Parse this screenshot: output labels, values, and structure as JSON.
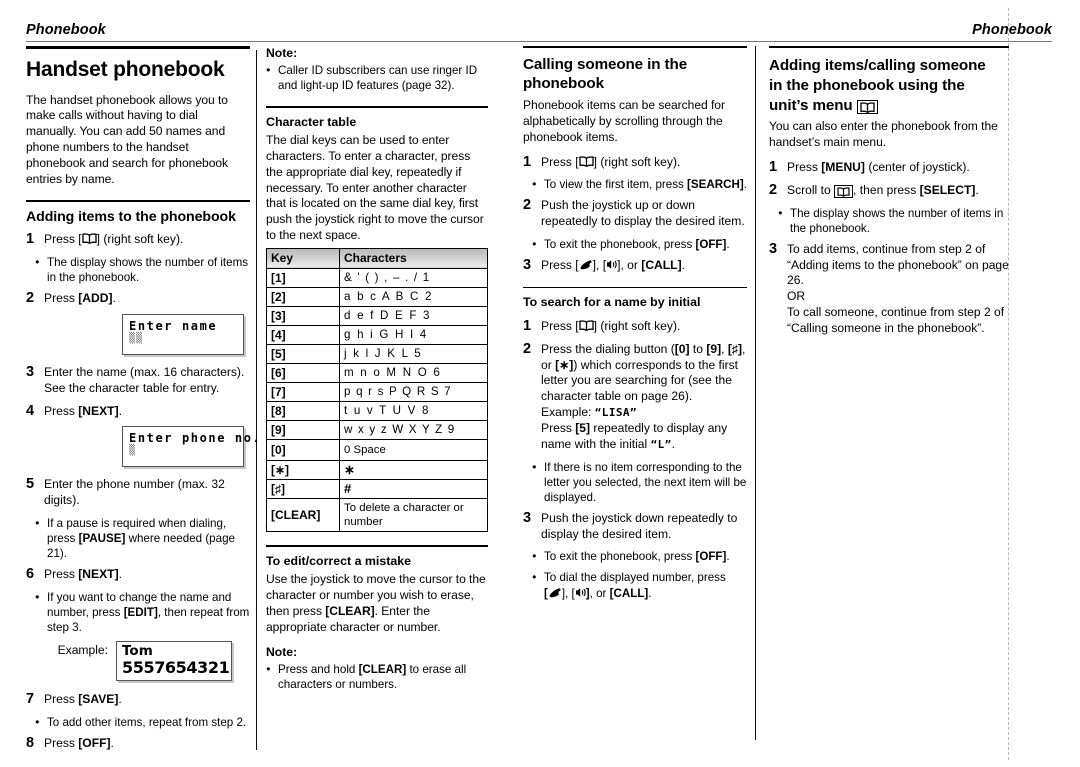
{
  "running_head": {
    "left": "Phonebook",
    "right": "Phonebook"
  },
  "col1": {
    "title": "Handset phonebook",
    "intro": "The handset phonebook allows you to make calls without having to dial manually. You can add 50 names and phone numbers to the handset phonebook and search for phonebook entries by name.",
    "subhead": "Adding items to the phonebook",
    "step1": {
      "num": "1",
      "pre": "Press [",
      "icon": "phonebook-book-icon",
      "post": "] (right soft key)."
    },
    "step1_bullet": "The display shows the number of items in the phonebook.",
    "step2": {
      "num": "2",
      "text_pre": "Press ",
      "key": "[ADD]",
      "text_post": "."
    },
    "lcd1": {
      "line1": "Enter name",
      "line2": ""
    },
    "step3": {
      "num": "3",
      "text": "Enter the name (max. 16 characters). See the character table for entry."
    },
    "step4": {
      "num": "4",
      "text_pre": "Press ",
      "key": "[NEXT]",
      "text_post": "."
    },
    "lcd2": {
      "line1": "Enter phone no.",
      "line2": ""
    },
    "step5": {
      "num": "5",
      "text": "Enter the phone number (max. 32 digits)."
    },
    "step5_bullet_pre": "If a pause is required when dialing, press ",
    "step5_bullet_key": "[PAUSE]",
    "step5_bullet_post": " where needed (page 21).",
    "step6": {
      "num": "6",
      "text_pre": "Press ",
      "key": "[NEXT]",
      "text_post": "."
    },
    "step6_bullet_pre": "If you want to change the name and number, press ",
    "step6_bullet_key": "[EDIT]",
    "step6_bullet_post": ", then repeat from step 3.",
    "example_label": "Example:",
    "example_lcd": {
      "name": "Tom",
      "number": "5557654321"
    },
    "step7": {
      "num": "7",
      "text_pre": "Press ",
      "key": "[SAVE]",
      "text_post": "."
    },
    "step7_bullet": "To add other items, repeat from step 2.",
    "step8": {
      "num": "8",
      "text_pre": "Press ",
      "key": "[OFF]",
      "text_post": "."
    }
  },
  "col2": {
    "note_label": "Note:",
    "note_text": "Caller ID subscribers can use ringer ID and light-up ID features (page 32).",
    "chartable_head": "Character table",
    "chartable_intro": "The dial keys can be used to enter characters. To enter a character, press the appropriate dial key, repeatedly if necessary. To enter another character that is located on the same dial key, first push the joystick right to move the cursor to the next space.",
    "table": {
      "headers": [
        "Key",
        "Characters"
      ],
      "rows": [
        {
          "key": "[1]",
          "chars": "&  '  (  )  ,  –  .  /  1",
          "style": "wide"
        },
        {
          "key": "[2]",
          "chars": "a  b  c  A  B  C  2",
          "style": ""
        },
        {
          "key": "[3]",
          "chars": "d  e  f  D  E  F  3",
          "style": ""
        },
        {
          "key": "[4]",
          "chars": "g  h  i  G  H  I  4",
          "style": ""
        },
        {
          "key": "[5]",
          "chars": "j  k  l  J  K  L  5",
          "style": ""
        },
        {
          "key": "[6]",
          "chars": "m  n  o  M  N  O  6",
          "style": ""
        },
        {
          "key": "[7]",
          "chars": "p  q  r  s  P  Q  R  S  7",
          "style": "wide"
        },
        {
          "key": "[8]",
          "chars": "t  u  v  T  U  V  8",
          "style": ""
        },
        {
          "key": "[9]",
          "chars": "w  x  y  z  W  X  Y  Z  9",
          "style": "wide"
        },
        {
          "key": "[0]",
          "chars": "0   Space",
          "style": "txt"
        },
        {
          "key": "[∗]",
          "chars": "∗",
          "style": "sym"
        },
        {
          "key": "[♯]",
          "chars": "#",
          "style": "sym"
        },
        {
          "key": "[CLEAR]",
          "chars": "To delete a character or number",
          "style": "txt"
        }
      ]
    },
    "edit_head": "To edit/correct a mistake",
    "edit_text_pre": "Use the joystick to move the cursor to the character or number you wish to erase, then press ",
    "edit_key": "[CLEAR]",
    "edit_text_post": ". Enter the appropriate character or number.",
    "note2_label": "Note:",
    "note2_pre": "Press and hold ",
    "note2_key": "[CLEAR]",
    "note2_post": " to erase all characters or numbers."
  },
  "col3": {
    "title": "Calling someone in the phonebook",
    "intro": "Phonebook items can be searched for alphabetically by scrolling through the phonebook items.",
    "step1": {
      "num": "1",
      "pre": "Press [",
      "icon": "phonebook-book-icon",
      "post": "] (right soft key)."
    },
    "step1_bullet_pre": "To view the first item, press ",
    "step1_bullet_key": "[SEARCH]",
    "step1_bullet_post": ".",
    "step2": {
      "num": "2",
      "text": "Push the joystick up or down repeatedly to display the desired item."
    },
    "step2_bullet_pre": "To exit the phonebook, press ",
    "step2_bullet_key": "[OFF]",
    "step2_bullet_post": ".",
    "step3": {
      "num": "3",
      "pre": "Press [",
      "post": "], [",
      "post2": "], or ",
      "key": "[CALL]",
      "end": "."
    },
    "search_head": "To search for a name by initial",
    "s1": {
      "num": "1",
      "pre": "Press [",
      "post": "] (right soft key)."
    },
    "s2": {
      "num": "2",
      "t1": "Press the dialing button (",
      "k0": "[0]",
      "t2": " to ",
      "k9": "[9]",
      "t3": ", ",
      "khash": "[♯]",
      "t4": ", or ",
      "kstar": "[∗]",
      "t5": ") which corresponds to the first letter you are searching for (see the character table on page 26).",
      "example_label": "Example: ",
      "example_value": "“LISA”",
      "press_pre": "Press ",
      "press_key": "[5]",
      "press_post": " repeatedly to display any name with the initial ",
      "press_letter": "“L”",
      "press_end": "."
    },
    "s2_bullet": "If there is no item corresponding to the letter you selected, the next item will be displayed.",
    "s3": {
      "num": "3",
      "text": "Push the joystick down repeatedly to display the desired item."
    },
    "s3_bullet1_pre": "To exit the phonebook, press ",
    "s3_bullet1_key": "[OFF]",
    "s3_bullet1_post": ".",
    "s3_bullet2_pre": "To dial the displayed number, press ",
    "s3_bullet2_mid": "], [",
    "s3_bullet2_key": "[CALL]",
    "s3_bullet2_end": "."
  },
  "col4": {
    "title_l1": "Adding items/calling someone",
    "title_l2": "in the phonebook using the",
    "title_l3": "unit’s menu",
    "intro": "You can also enter the phonebook from the handset’s main menu.",
    "step1": {
      "num": "1",
      "pre": "Press ",
      "key": "[MENU]",
      "post": " (center of joystick)."
    },
    "step2": {
      "num": "2",
      "pre": "Scroll to ",
      "mid": ", then press ",
      "key": "[SELECT]",
      "post": "."
    },
    "step2_bullet": "The display shows the number of items in the phonebook.",
    "step3": {
      "num": "3",
      "l1": "To add items, continue from step 2 of “Adding items to the phonebook” on page 26.",
      "or": "OR",
      "l2": "To call someone, continue from step 2 of “Calling someone in the phonebook”."
    }
  }
}
